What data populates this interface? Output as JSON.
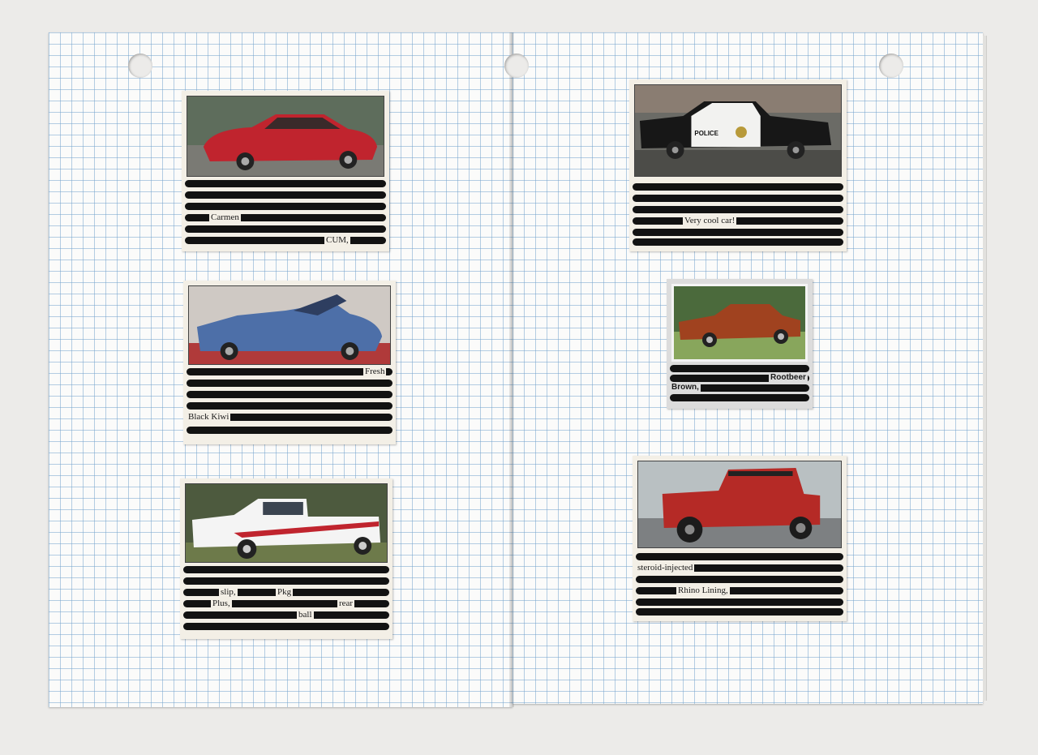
{
  "notebook": {
    "paper_color": "#fbfbfa",
    "grid_color": "#78a5cd"
  },
  "clippings": {
    "firebird": {
      "visible_words": [
        "Carmen",
        "CUM,"
      ],
      "car_color": "#c0242e"
    },
    "shelby": {
      "visible_words": [
        "Fresh",
        "Black Kiwi"
      ],
      "car_color": "#4d6fa8"
    },
    "ford_truck": {
      "visible_words": [
        "slip,",
        "Pkg",
        "Plus,",
        "rear",
        "ball"
      ],
      "car_color": "#f4f4f4",
      "stripe_color": "#c0242e"
    },
    "police_car": {
      "visible_words": [
        "Very cool car!"
      ],
      "door_text": "POLICE"
    },
    "challenger": {
      "visible_words": [
        "Rootbeer",
        "Brown,"
      ],
      "car_color": "#a0421f"
    },
    "bronco": {
      "visible_words": [
        "steroid-injected",
        "Rhino Lining,"
      ],
      "car_color": "#b52a26"
    }
  }
}
